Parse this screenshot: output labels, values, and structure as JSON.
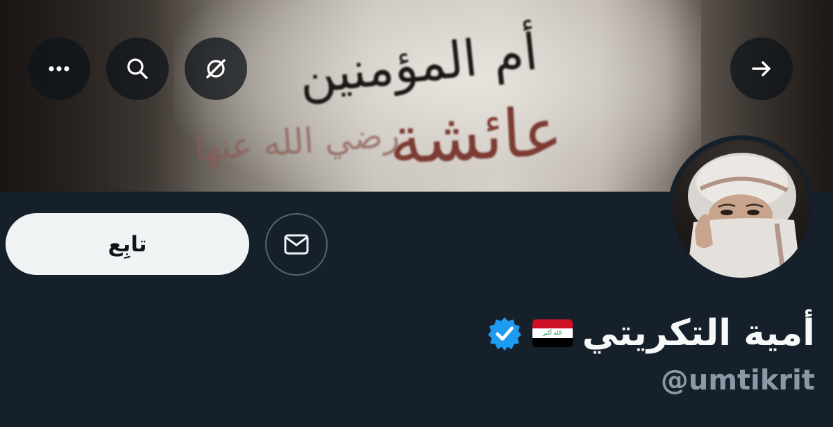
{
  "header": {
    "back_icon": "arrow-right-icon",
    "grok_icon": "slashed-circle-icon",
    "search_icon": "search-icon",
    "more_icon": "more-horizontal-icon"
  },
  "banner": {
    "text_line1": "أم المؤمنين",
    "text_line2": "عائشة",
    "text_line3": "رضي الله عنها"
  },
  "profile": {
    "display_name": "أمية التكريتي",
    "handle": "@umtikrit",
    "verified": true,
    "flag": "iraq-flag",
    "flag_text": "الله أكبر"
  },
  "actions": {
    "follow_label": "تابِع",
    "message_icon": "mail-icon"
  },
  "colors": {
    "background": "#15202b",
    "button_bg": "#eff3f4",
    "verified_blue": "#1d9bf0",
    "handle_gray": "#8b98a5"
  }
}
